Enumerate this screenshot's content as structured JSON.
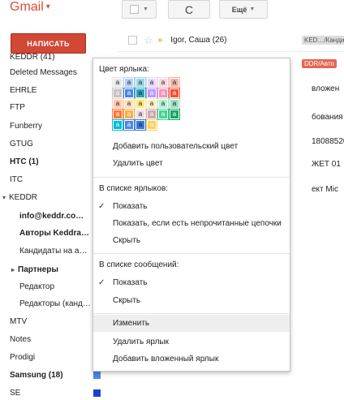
{
  "header": {
    "app_title": "Gmail",
    "refresh_glyph": "C",
    "more_label": "Ещё"
  },
  "compose_label": "НАПИСАТЬ",
  "sidebar": {
    "items": [
      {
        "label": "KEDDR (41)",
        "bold": false
      },
      {
        "label": "Deleted Messages",
        "bold": false
      },
      {
        "label": "EHRLE",
        "bold": false
      },
      {
        "label": "FTP",
        "bold": false
      },
      {
        "label": "Funberry",
        "bold": false
      },
      {
        "label": "GTUG",
        "bold": false
      },
      {
        "label": "HTC (1)",
        "bold": true
      },
      {
        "label": "ITC",
        "bold": false
      },
      {
        "label": "KEDDR",
        "bold": false
      },
      {
        "label": "info@keddr.co…",
        "bold": true
      },
      {
        "label": "Авторы Keddra…",
        "bold": true
      },
      {
        "label": "Кандидаты на а…",
        "bold": false
      },
      {
        "label": "Партнеры",
        "bold": true
      },
      {
        "label": "Редактор",
        "bold": false
      },
      {
        "label": "Редакторы (канд…",
        "bold": false
      },
      {
        "label": "MTV",
        "bold": false
      },
      {
        "label": "Notes",
        "bold": false
      },
      {
        "label": "Prodigi",
        "bold": false
      },
      {
        "label": "Samsung (18)",
        "bold": true
      },
      {
        "label": "SE",
        "bold": false
      }
    ]
  },
  "mail": {
    "first_sender": "Igor, Саша (26)",
    "first_tag": "KED…/Канди",
    "second_tag": "DDR/Авто",
    "snippets": [
      "вложен",
      "бования",
      "18088520",
      "ЖЕТ 01",
      "ект Mic"
    ]
  },
  "menu": {
    "label_color_header": "Цвет ярлыка:",
    "add_custom_color": "Добавить пользовательский цвет",
    "remove_color": "Удалить цвет",
    "label_list_header": "В списке ярлыков:",
    "show": "Показать",
    "show_if_unread": "Показать, если есть непрочитанные цепочки",
    "hide": "Скрыть",
    "message_list_header": "В списке сообщений:",
    "msg_show": "Показать",
    "msg_hide": "Скрыть",
    "edit": "Изменить",
    "delete_label": "Удалить ярлык",
    "add_sublabel": "Добавить вложенный ярлык"
  },
  "swatch_letter": "a",
  "swatch_colors": [
    [
      "#e7e7e7",
      "#b6cff5",
      "#98d7e4",
      "#e3d7ff",
      "#fbd3e0",
      "#f2b2a8"
    ],
    [
      "#c2c2c2",
      "#4986e7",
      "#2da2bb",
      "#b99aff",
      "#f691b2",
      "#fb4c2f"
    ],
    [
      "#ffc8af",
      "#ffdeb5",
      "#fbe983",
      "#fdedc1",
      "#b3efd3",
      "#a2dcc1"
    ],
    [
      "#ff7537",
      "#ffad46",
      "#ebdbde",
      "#cca6ac",
      "#42d692",
      "#16a765"
    ],
    [
      "#00bcd4",
      "#4a86e8",
      "#3c78d8",
      "#fad165"
    ]
  ],
  "accent_color": "#d14836"
}
